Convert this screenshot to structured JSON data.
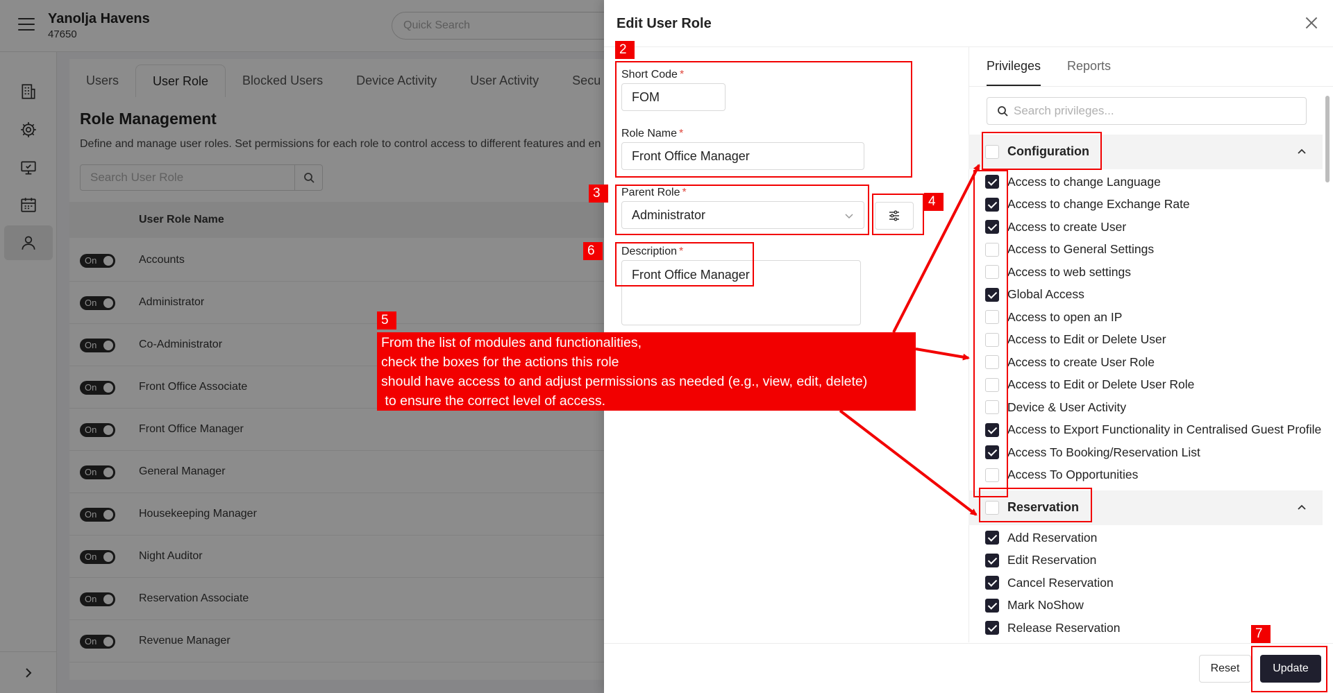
{
  "app": {
    "property_name": "Yanolja Havens",
    "property_id": "47650",
    "quick_search_placeholder": "Quick Search"
  },
  "sidebar": {
    "items": [
      {
        "icon": "building-icon"
      },
      {
        "icon": "gear-icon"
      },
      {
        "icon": "monitor-icon"
      },
      {
        "icon": "calendar-icon"
      },
      {
        "icon": "user-icon",
        "active": true
      }
    ],
    "expand_icon": "chevron-right-icon"
  },
  "main": {
    "tabs": [
      "Users",
      "User Role",
      "Blocked Users",
      "Device Activity",
      "User Activity",
      "Secu"
    ],
    "active_tab": "User Role",
    "title": "Role Management",
    "description": "Define and manage user roles. Set permissions for each role to control access to different features and en",
    "search_placeholder": "Search User Role",
    "column_header": "User Role Name",
    "toggle_label": "On",
    "roles": [
      "Accounts",
      "Administrator",
      "Co-Administrator",
      "Front Office Associate",
      "Front Office Manager",
      "General Manager",
      "Housekeeping Manager",
      "Night Auditor",
      "Reservation Associate",
      "Revenue Manager"
    ]
  },
  "drawer": {
    "title": "Edit User Role",
    "short_code_label": "Short Code",
    "short_code_value": "FOM",
    "role_name_label": "Role Name",
    "role_name_value": "Front Office Manager",
    "parent_role_label": "Parent Role",
    "parent_role_value": "Administrator",
    "description_label": "Description",
    "description_value": "Front Office Manager",
    "required_mark": "*",
    "privilege_tabs": [
      "Privileges",
      "Reports"
    ],
    "privilege_search_placeholder": "Search privileges...",
    "groups": [
      {
        "title": "Configuration",
        "checked": false,
        "items": [
          {
            "label": "Access to change Language",
            "checked": true
          },
          {
            "label": "Access to change Exchange Rate",
            "checked": true
          },
          {
            "label": "Access to create User",
            "checked": true
          },
          {
            "label": "Access to General Settings",
            "checked": false
          },
          {
            "label": "Access to web settings",
            "checked": false
          },
          {
            "label": "Global Access",
            "checked": true
          },
          {
            "label": "Access to open an IP",
            "checked": false
          },
          {
            "label": "Access to Edit or Delete User",
            "checked": false
          },
          {
            "label": "Access to create User Role",
            "checked": false
          },
          {
            "label": "Access to Edit or Delete User Role",
            "checked": false
          },
          {
            "label": "Device & User Activity",
            "checked": false
          },
          {
            "label": "Access to Export Functionality in Centralised Guest Profile",
            "checked": true
          },
          {
            "label": "Access To Booking/Reservation List",
            "checked": true
          },
          {
            "label": "Access To Opportunities",
            "checked": false
          }
        ]
      },
      {
        "title": "Reservation",
        "checked": false,
        "items": [
          {
            "label": "Add Reservation",
            "checked": true
          },
          {
            "label": "Edit Reservation",
            "checked": true
          },
          {
            "label": "Cancel Reservation",
            "checked": true
          },
          {
            "label": "Mark NoShow",
            "checked": true
          },
          {
            "label": "Release Reservation",
            "checked": true
          }
        ]
      }
    ],
    "reset_label": "Reset",
    "update_label": "Update"
  },
  "annotations": {
    "color": "#f20000",
    "markers": [
      "2",
      "3",
      "4",
      "5",
      "6",
      "7"
    ],
    "callout_lines": [
      "From the list of modules and functionalities,",
      "check the boxes for the actions this role",
      "should have access to and adjust permissions as needed (e.g., view, edit, delete)",
      " to ensure the correct level of access."
    ]
  }
}
